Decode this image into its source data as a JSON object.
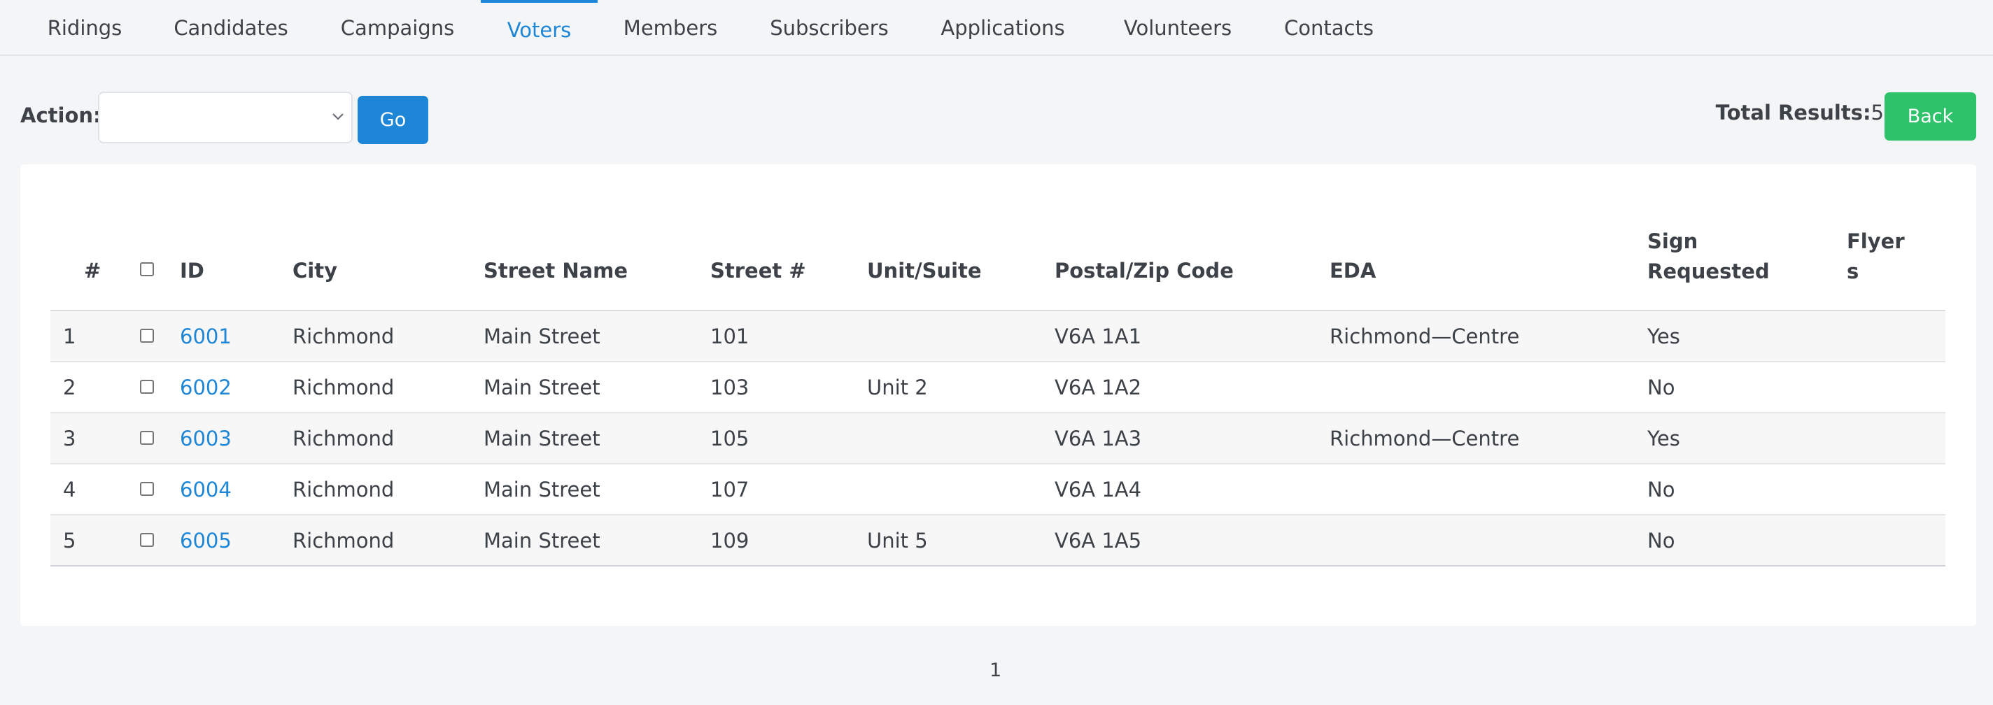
{
  "tabs": [
    {
      "label": "Ridings",
      "active": false
    },
    {
      "label": "Candidates",
      "active": false
    },
    {
      "label": "Campaigns",
      "active": false
    },
    {
      "label": "Voters",
      "active": true
    },
    {
      "label": "Members",
      "active": false
    },
    {
      "label": "Subscribers",
      "active": false
    },
    {
      "label": "Applications",
      "active": false
    },
    {
      "label": "Volunteers",
      "active": false
    },
    {
      "label": "Contacts",
      "active": false
    }
  ],
  "toolbar": {
    "action_label": "Action:",
    "action_value": "",
    "go_label": "Go",
    "total_label": "Total Results:",
    "total_value": "5",
    "back_label": "Back"
  },
  "table": {
    "headers": {
      "num": "#",
      "id": "ID",
      "city": "City",
      "street_name": "Street Name",
      "street_num": "Street #",
      "unit": "Unit/Suite",
      "postal": "Postal/Zip Code",
      "eda": "EDA",
      "sign_line1": "Sign",
      "sign_line2": "Requested",
      "flyers_line1": "Flyer",
      "flyers_line2": "s"
    },
    "rows": [
      {
        "num": "1",
        "id": "6001",
        "city": "Richmond",
        "street_name": "Main Street",
        "street_num": "101",
        "unit": "",
        "postal": "V6A 1A1",
        "eda": "Richmond—Centre",
        "sign": "Yes",
        "flyers": ""
      },
      {
        "num": "2",
        "id": "6002",
        "city": "Richmond",
        "street_name": "Main Street",
        "street_num": "103",
        "unit": "Unit 2",
        "postal": "V6A 1A2",
        "eda": "",
        "sign": "No",
        "flyers": ""
      },
      {
        "num": "3",
        "id": "6003",
        "city": "Richmond",
        "street_name": "Main Street",
        "street_num": "105",
        "unit": "",
        "postal": "V6A 1A3",
        "eda": "Richmond—Centre",
        "sign": "Yes",
        "flyers": ""
      },
      {
        "num": "4",
        "id": "6004",
        "city": "Richmond",
        "street_name": "Main Street",
        "street_num": "107",
        "unit": "",
        "postal": "V6A 1A4",
        "eda": "",
        "sign": "No",
        "flyers": ""
      },
      {
        "num": "5",
        "id": "6005",
        "city": "Richmond",
        "street_name": "Main Street",
        "street_num": "109",
        "unit": "Unit 5",
        "postal": "V6A 1A5",
        "eda": "",
        "sign": "No",
        "flyers": ""
      }
    ]
  },
  "pagination": {
    "current": "1"
  },
  "icons": {
    "select_arrow": "chevron-down-icon"
  },
  "colors": {
    "accent": "#1e86d6",
    "back_button": "#2ec26a"
  }
}
